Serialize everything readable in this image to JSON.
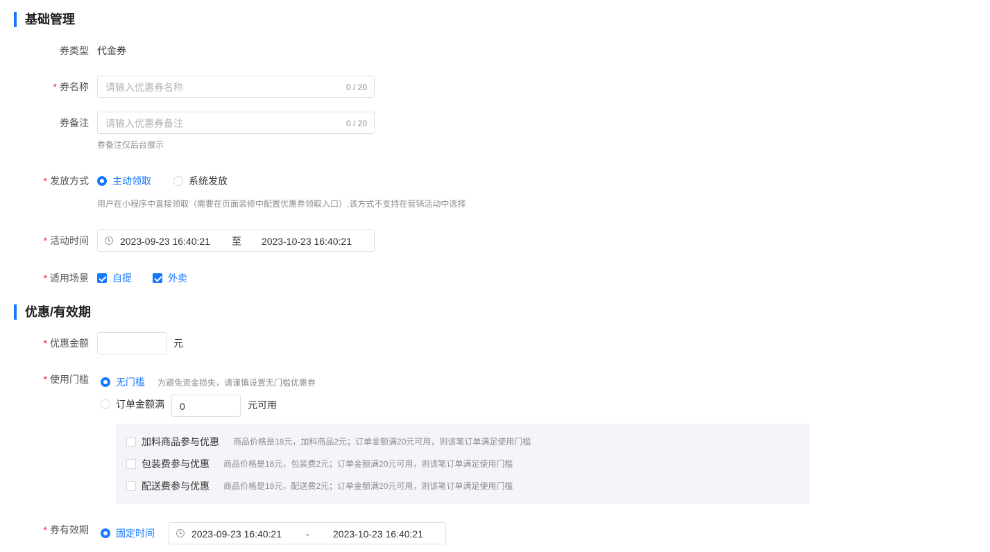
{
  "basic": {
    "title": "基础管理",
    "coupon_type": {
      "label": "券类型",
      "value": "代金券"
    },
    "coupon_name": {
      "label": "券名称",
      "placeholder": "请输入优惠券名称",
      "counter": "0 / 20"
    },
    "coupon_remark": {
      "label": "券备注",
      "placeholder": "请输入优惠券备注",
      "counter": "0 / 20",
      "hint": "券备注仅后台展示"
    },
    "distribution": {
      "label": "发放方式",
      "options": [
        "主动领取",
        "系统发放"
      ],
      "selected": "主动领取",
      "hint": "用户在小程序中直接领取（需要在页面装修中配置优惠券领取入口）,该方式不支持在营销活动中选择"
    },
    "activity_time": {
      "label": "活动时间",
      "start": "2023-09-23 16:40:21",
      "separator": "至",
      "end": "2023-10-23 16:40:21"
    },
    "scenes": {
      "label": "适用场景",
      "options": [
        "自提",
        "外卖"
      ],
      "checked": [
        "自提",
        "外卖"
      ]
    }
  },
  "discount": {
    "title": "优惠/有效期",
    "amount": {
      "label": "优惠金额",
      "value": "",
      "unit": "元"
    },
    "threshold": {
      "label": "使用门槛",
      "no_threshold": "无门槛",
      "no_threshold_hint": "为避免资金损失，请谨慎设置无门槛优惠券",
      "order_min_label": "订单金额满",
      "order_min_value": "0",
      "order_min_unit": "元可用",
      "selected": "无门槛",
      "extras": [
        {
          "label": "加料商品参与优惠",
          "desc": "商品价格是18元，加料商品2元；订单金额满20元可用，则该笔订单满足使用门槛"
        },
        {
          "label": "包装费参与优惠",
          "desc": "商品价格是18元，包装费2元；订单金额满20元可用，则该笔订单满足使用门槛"
        },
        {
          "label": "配送费参与优惠",
          "desc": "商品价格是18元，配送费2元；订单金额满20元可用，则该笔订单满足使用门槛"
        }
      ]
    },
    "validity": {
      "label": "券有效期",
      "option": "固定时间",
      "start": "2023-09-23 16:40:21",
      "separator": "-",
      "end": "2023-10-23 16:40:21"
    }
  },
  "colors": {
    "accent": "#1677ff",
    "required": "#f5222d",
    "panel_bg": "#f4f5f8"
  }
}
